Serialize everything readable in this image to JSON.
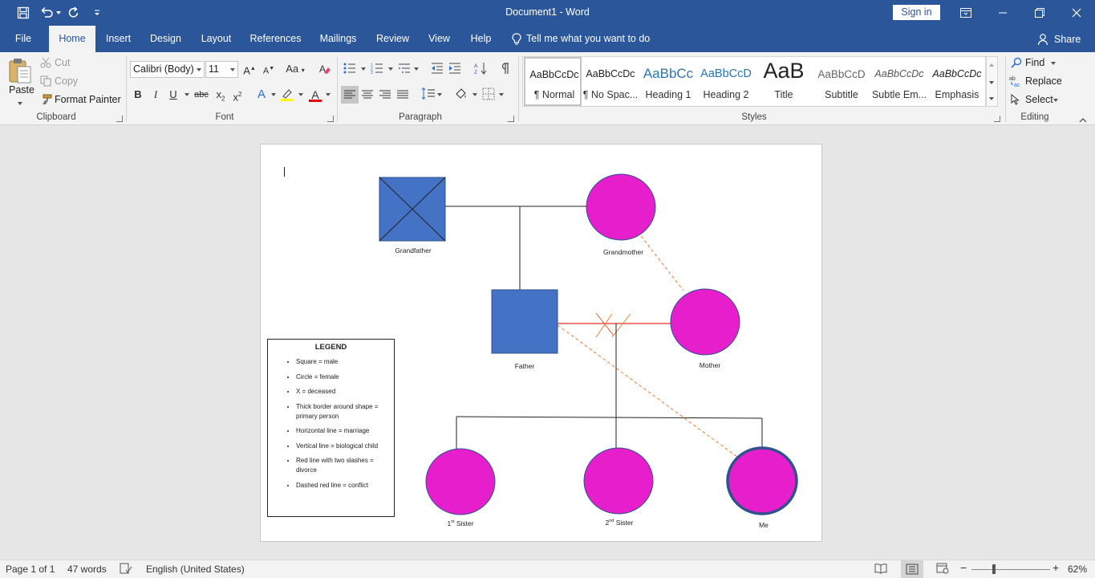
{
  "window": {
    "title": "Document1  -  Word",
    "sign_in": "Sign in"
  },
  "tabs": [
    "File",
    "Home",
    "Insert",
    "Design",
    "Layout",
    "References",
    "Mailings",
    "Review",
    "View",
    "Help"
  ],
  "active_tab": "Home",
  "tell_me": "Tell me what you want to do",
  "share": "Share",
  "clipboard": {
    "paste": "Paste",
    "cut": "Cut",
    "copy": "Copy",
    "format_painter": "Format Painter",
    "label": "Clipboard"
  },
  "font": {
    "name": "Calibri (Body)",
    "size": "11",
    "label": "Font",
    "bold": "B",
    "italic": "I",
    "underline": "U",
    "strike": "abc",
    "subscript": "x",
    "subscript_mark": "2",
    "superscript": "x",
    "superscript_mark": "2",
    "change_case": "Aa",
    "grow": "A",
    "shrink": "A",
    "text_effects": "A",
    "font_color": "A"
  },
  "paragraph": {
    "label": "Paragraph"
  },
  "styles": {
    "label": "Styles",
    "items": [
      {
        "preview": "AaBbCcDc",
        "name": "¶ Normal"
      },
      {
        "preview": "AaBbCcDc",
        "name": "¶ No Spac..."
      },
      {
        "preview": "AaBbCc",
        "name": "Heading 1"
      },
      {
        "preview": "AaBbCcD",
        "name": "Heading 2"
      },
      {
        "preview": "AaB",
        "name": "Title"
      },
      {
        "preview": "AaBbCcD",
        "name": "Subtitle"
      },
      {
        "preview": "AaBbCcDc",
        "name": "Subtle Em..."
      },
      {
        "preview": "AaBbCcDc",
        "name": "Emphasis"
      }
    ]
  },
  "editing": {
    "find": "Find",
    "replace": "Replace",
    "select": "Select",
    "label": "Editing"
  },
  "diagram": {
    "grandfather": "Grandfather",
    "grandmother": "Grandmother",
    "father": "Father",
    "mother": "Mother",
    "sister1": "1",
    "sister1_sup": "st",
    "sister1_rest": " Sister",
    "sister2": "2",
    "sister2_sup": "nd",
    "sister2_rest": " Sister",
    "me": "Me",
    "colors": {
      "male": "#4472c4",
      "female": "#e61ecc",
      "line": "#222222",
      "divorce": "#e03020",
      "conflict": "#ed7d31",
      "primary_border": "#2f528f"
    }
  },
  "legend": {
    "title": "LEGEND",
    "items": [
      "Square = male",
      "Circle = female",
      "X = deceased",
      "Thick border around shape = primary person",
      "Horizontal line = marriage",
      "Vertical line = biological child",
      "Red line with two slashes = divorce",
      "Dashed red line = conflict"
    ]
  },
  "status": {
    "page": "Page 1 of 1",
    "words": "47 words",
    "language": "English (United States)",
    "zoom": "62%"
  }
}
